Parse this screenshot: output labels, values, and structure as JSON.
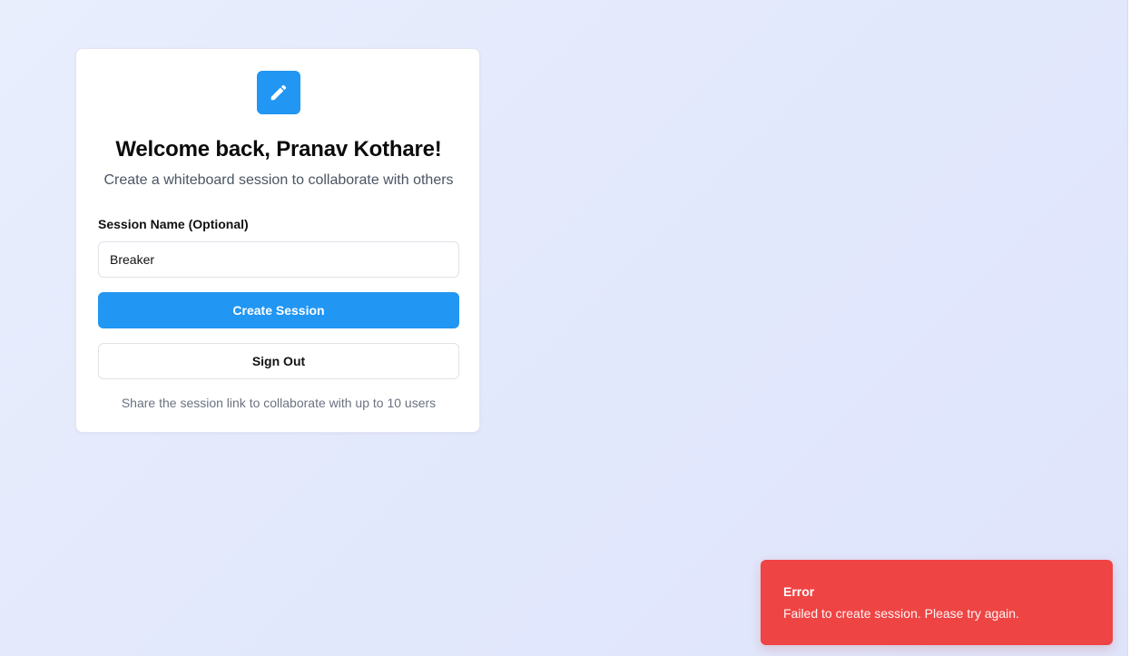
{
  "card": {
    "icon": "pencil-icon",
    "title": "Welcome back, Pranav Kothare!",
    "subtitle": "Create a whiteboard session to collaborate with others",
    "session_field": {
      "label": "Session Name (Optional)",
      "value": "Breaker"
    },
    "create_button_label": "Create Session",
    "signout_button_label": "Sign Out",
    "footnote": "Share the session link to collaborate with up to 10 users"
  },
  "toast": {
    "title": "Error",
    "message": "Failed to create session. Please try again."
  },
  "colors": {
    "accent": "#2196f3",
    "error": "#ef4444",
    "background": "#e6ebfc"
  }
}
